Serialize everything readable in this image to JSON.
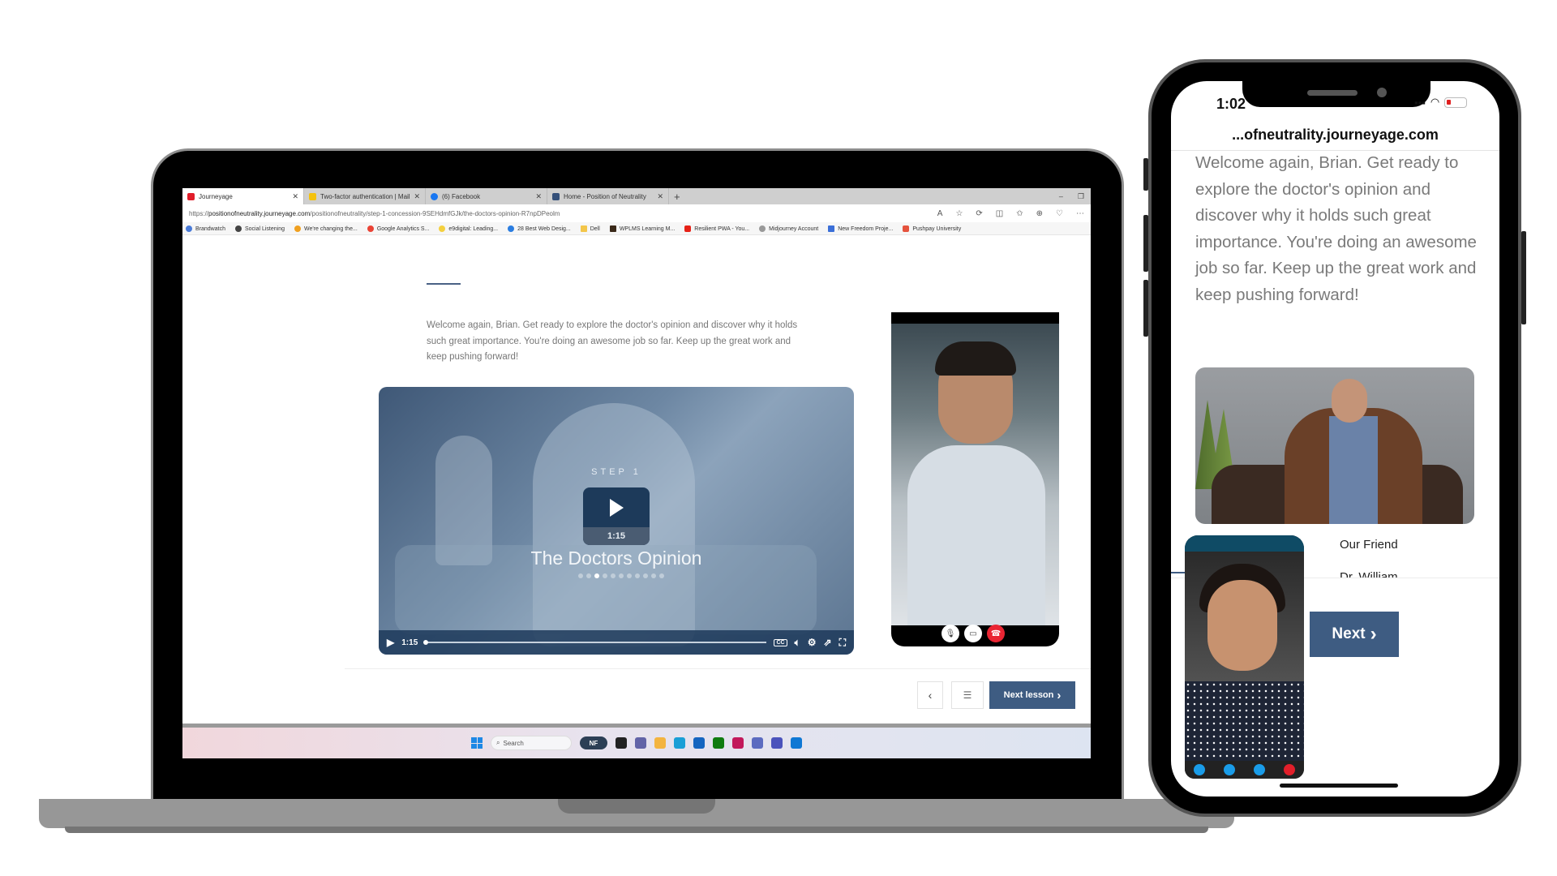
{
  "browser": {
    "tabs": [
      {
        "label": "Journeyage",
        "icon": "journeyage-icon",
        "color": "#e11d2a",
        "active": true
      },
      {
        "label": "Two-factor authentication | Mailc",
        "icon": "mailchimp-icon",
        "color": "#f4c20d",
        "active": false
      },
      {
        "label": "(6) Facebook",
        "icon": "facebook-icon",
        "color": "#1877f2",
        "active": false
      },
      {
        "label": "Home - Position of Neutrality",
        "icon": "site-icon",
        "color": "#34507a",
        "active": false
      }
    ],
    "new_tab": "+",
    "window_controls": {
      "minimize": "–",
      "restore": "❐"
    },
    "url_prefix": "https://",
    "url_host": "positionofneutrality.journeyage.com",
    "url_path": "/positionofneutrality/step-1-concession-9SEHdmfGJk/the-doctors-opinion-R7npDPeolm",
    "toolbar_icons": [
      "read-aloud-icon",
      "favorite-star-icon",
      "extensions-icon",
      "split-screen-icon",
      "favorites-icon",
      "collections-icon",
      "health-icon",
      "more-icon"
    ],
    "bookmarks": [
      {
        "label": "Brandwatch",
        "color": "#4a7bd8"
      },
      {
        "label": "Social Listening",
        "color": "#444"
      },
      {
        "label": "We're changing the...",
        "color": "#f0a020"
      },
      {
        "label": "Google Analytics S...",
        "color": "#ea4335"
      },
      {
        "label": "e9digital: Leading...",
        "color": "#f4d03f"
      },
      {
        "label": "28 Best Web Desig...",
        "color": "#2a7de1"
      },
      {
        "label": "Dell",
        "color": "#f3c64b"
      },
      {
        "label": "WPLMS Learning M...",
        "color": "#3b2a1a"
      },
      {
        "label": "Resilient PWA - You...",
        "color": "#e62117"
      },
      {
        "label": "Midjourney Account",
        "color": "#999"
      },
      {
        "label": "New Freedom Proje...",
        "color": "#3b6fd8"
      },
      {
        "label": "Pushpay University",
        "color": "#e5533d"
      }
    ]
  },
  "lesson": {
    "intro": "Welcome again, Brian. Get ready to explore the doctor's opinion and discover why it holds such great importance. You're doing an awesome job so far. Keep up the great work and keep pushing forward!",
    "video": {
      "step_label": "STEP 1",
      "title": "The Doctors Opinion",
      "duration": "1:15",
      "current_time": "1:15",
      "progress": 0,
      "slide_index": 3,
      "slide_count": 11,
      "cc_label": "CC"
    },
    "nav": {
      "prev_label": "‹",
      "next_label": "Next lesson",
      "next_chevron": "›"
    }
  },
  "video_call": {
    "controls": [
      "mic-icon",
      "camera-icon",
      "hang-up-icon"
    ]
  },
  "taskbar": {
    "search_placeholder": "Search",
    "user_badge": "NF",
    "apps": [
      {
        "name": "task-view-icon",
        "color": "#222"
      },
      {
        "name": "teams-chat-icon",
        "color": "#6264a7"
      },
      {
        "name": "file-explorer-icon",
        "color": "#f3b43f"
      },
      {
        "name": "edge-icon",
        "color": "#1a9fd6"
      },
      {
        "name": "store-icon",
        "color": "#1565c0"
      },
      {
        "name": "xbox-icon",
        "color": "#107c10"
      },
      {
        "name": "media-app-icon",
        "color": "#c2185b"
      },
      {
        "name": "browser-app-icon",
        "color": "#5c6bc0"
      },
      {
        "name": "teams-icon",
        "color": "#4b53bc"
      },
      {
        "name": "outlook-icon",
        "color": "#0f78d4"
      }
    ]
  },
  "phone": {
    "time": "1:02",
    "url": "...ofneutrality.journeyage.com",
    "intro": "Welcome again, Brian. Get ready to explore the doctor's opinion and discover why it holds such great importance. You're doing an awesome job so far. Keep up the great work and keep pushing forward!",
    "caption_line1": "Our Friend",
    "caption_line2": "Dr. William",
    "next_label": "Next",
    "next_chevron": "›",
    "call_controls": [
      "video-icon",
      "signal-icon",
      "chat-icon",
      "end-call-icon"
    ]
  },
  "colors": {
    "accent": "#3e5c82",
    "video_overlay": "#1d3a5a",
    "hang_up": "#ea2533"
  }
}
